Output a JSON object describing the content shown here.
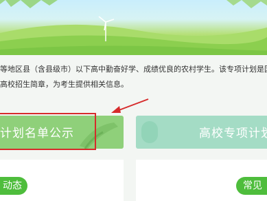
{
  "intro": {
    "line1": "等地区县（含县级市）以下高中勤奋好学、成绩优良的农村学生。该专项计划是国",
    "line2": "高校招生简章，为考生提供相关信息。"
  },
  "cards": {
    "left_label": "计划名单公示",
    "right_label": "高校专项计划"
  },
  "sections": {
    "left_tag": "动态",
    "right_tag": "常见"
  },
  "colors": {
    "accent_green": "#4ebd3c",
    "card_green": "#8fd07a",
    "card_teal": "#a4dcc5",
    "annotation_red": "#d62b2b"
  }
}
